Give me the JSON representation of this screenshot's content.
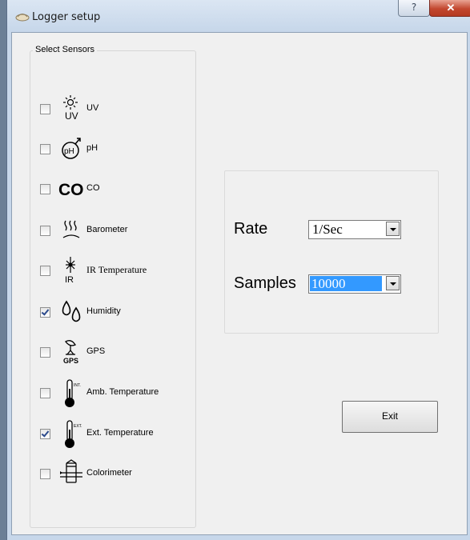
{
  "window": {
    "title": "Logger setup",
    "help_glyph": "?",
    "close_glyph": "✕",
    "app_icon": "logger-app-icon"
  },
  "sensors_group": {
    "title": "Select Sensors",
    "items": [
      {
        "label": "UV",
        "checked": false,
        "icon": "uv-sun-icon"
      },
      {
        "label": "pH",
        "checked": false,
        "icon": "ph-meter-icon"
      },
      {
        "label": "CO",
        "checked": false,
        "icon": "co-text-icon",
        "icon_text": "CO"
      },
      {
        "label": "Barometer",
        "checked": false,
        "icon": "barometer-icon"
      },
      {
        "label": "IR Temperature",
        "checked": false,
        "icon": "ir-temperature-icon",
        "icon_text": "IR"
      },
      {
        "label": "Humidity",
        "checked": true,
        "icon": "humidity-drops-icon"
      },
      {
        "label": "GPS",
        "checked": false,
        "icon": "gps-satellite-icon",
        "icon_text": "GPS"
      },
      {
        "label": "Amb. Temperature",
        "checked": false,
        "icon": "ambient-thermometer-icon",
        "icon_text": "INT."
      },
      {
        "label": "Ext. Temperature",
        "checked": true,
        "icon": "external-thermometer-icon",
        "icon_text": "EXT."
      },
      {
        "label": "Colorimeter",
        "checked": false,
        "icon": "colorimeter-icon"
      }
    ]
  },
  "settings": {
    "rate_label": "Rate",
    "rate_value": "1/Sec",
    "samples_label": "Samples",
    "samples_value": "10000"
  },
  "exit_label": "Exit"
}
